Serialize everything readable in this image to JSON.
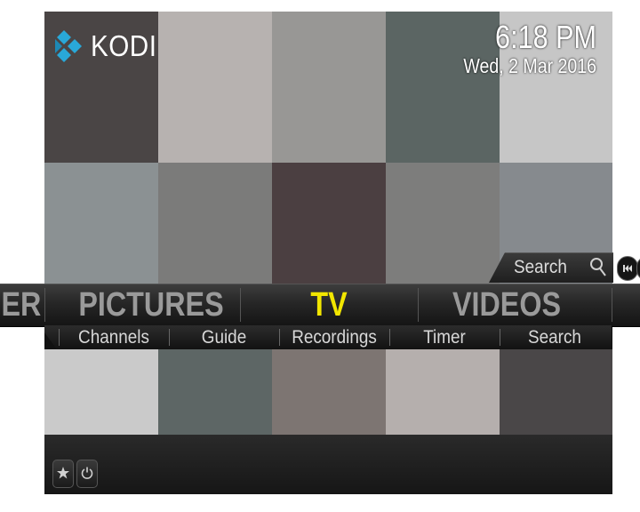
{
  "app": {
    "name": "KODI"
  },
  "clock": {
    "time": "6:18 PM",
    "date": "Wed, 2 Mar 2016"
  },
  "tiles": {
    "row1": [
      "#4a4545",
      "#b7b2b0",
      "#989795",
      "#5b6563",
      "#c6c6c6"
    ],
    "row2": [
      "#8b9193",
      "#7b7b7a",
      "#4b3f41",
      "#7d7d7c",
      "#868a8e"
    ],
    "row3": [
      "#cacaca",
      "#5d6665",
      "#7d7572",
      "#b5afad",
      "#4a4748"
    ]
  },
  "search": {
    "label": "Search"
  },
  "main_menu": {
    "items": [
      {
        "label": "IER",
        "active": false
      },
      {
        "label": "PICTURES",
        "active": false
      },
      {
        "label": "TV",
        "active": true
      },
      {
        "label": "VIDEOS",
        "active": false
      }
    ]
  },
  "sub_menu": {
    "items": [
      "Channels",
      "Guide",
      "Recordings",
      "Timer",
      "Search"
    ]
  },
  "colors": {
    "accent": "#f2e600",
    "menu_text": "#9a9a9a"
  },
  "icons": [
    "kodi-logo-icon",
    "search-icon",
    "skip-back-icon",
    "favourites-star-icon",
    "power-icon"
  ]
}
